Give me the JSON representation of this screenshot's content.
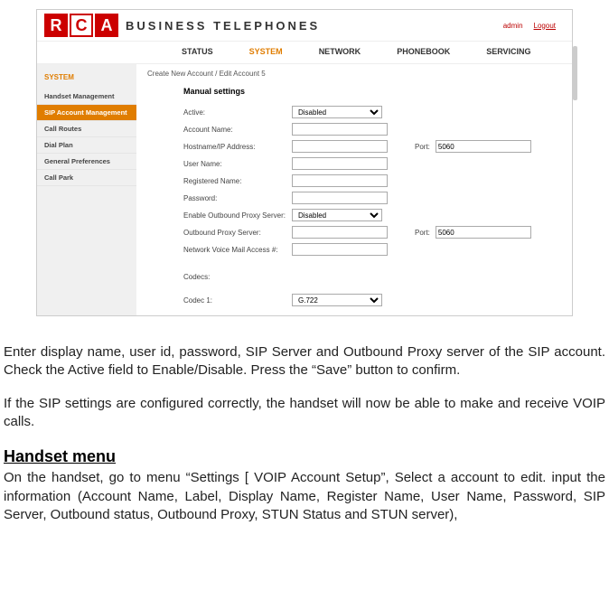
{
  "brand": {
    "line1": "BUSINESS TELEPHONES"
  },
  "top": {
    "user": "admin",
    "logout": "Logout"
  },
  "nav": {
    "items": [
      "STATUS",
      "SYSTEM",
      "NETWORK",
      "PHONEBOOK",
      "SERVICING"
    ],
    "active_index": 1
  },
  "sidebar": {
    "title": "SYSTEM",
    "items": [
      "Handset Management",
      "SIP Account Management",
      "Call Routes",
      "Dial Plan",
      "General Preferences",
      "Call Park"
    ],
    "selected_index": 1
  },
  "crumb": "Create New Account / Edit Account 5",
  "section": "Manual settings",
  "form": {
    "active_label": "Active:",
    "active_value": "Disabled",
    "account_name_label": "Account Name:",
    "account_name_value": "",
    "host_label": "Hostname/IP Address:",
    "host_value": "",
    "host_port_label": "Port:",
    "host_port_value": "5060",
    "user_label": "User Name:",
    "user_value": "",
    "reg_label": "Registered Name:",
    "reg_value": "",
    "pass_label": "Password:",
    "pass_value": "",
    "proxy_enable_label": "Enable Outbound Proxy Server:",
    "proxy_enable_value": "Disabled",
    "proxy_server_label": "Outbound Proxy Server:",
    "proxy_server_value": "",
    "proxy_port_label": "Port:",
    "proxy_port_value": "5060",
    "vmail_label": "Network Voice Mail Access #:",
    "vmail_value": "",
    "codecs_label": "Codecs:",
    "codec1_label": "Codec 1:",
    "codec1_value": "G.722"
  },
  "doc": {
    "p1": "Enter display name, user id, password, SIP Server and Outbound Proxy server of the SIP account. Check the Active field to Enable/Disable. Press the “Save” button to confirm.",
    "p2": "If the SIP settings are configured correctly, the handset will now be able to make and receive VOIP calls.",
    "h": "Handset menu",
    "p3": "On the handset, go to menu “Settings [ VOIP Account Setup”, Select a account to edit. input the information (Account Name, Label, Display Name, Register Name, User Name, Password, SIP Server, Outbound status, Outbound Proxy, STUN Status and STUN server),"
  }
}
